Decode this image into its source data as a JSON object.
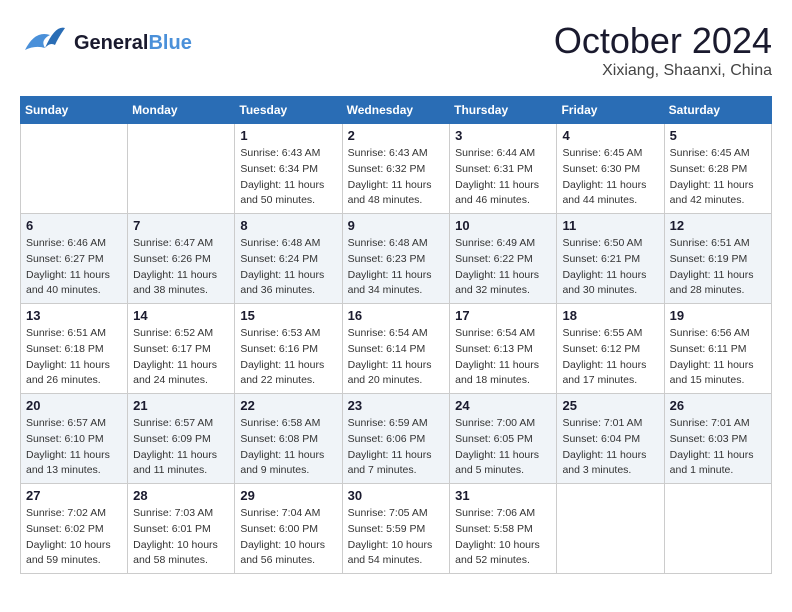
{
  "header": {
    "logo_general": "General",
    "logo_blue": "Blue",
    "month": "October 2024",
    "location": "Xixiang, Shaanxi, China"
  },
  "weekdays": [
    "Sunday",
    "Monday",
    "Tuesday",
    "Wednesday",
    "Thursday",
    "Friday",
    "Saturday"
  ],
  "weeks": [
    [
      {
        "day": "",
        "sunrise": "",
        "sunset": "",
        "daylight": ""
      },
      {
        "day": "",
        "sunrise": "",
        "sunset": "",
        "daylight": ""
      },
      {
        "day": "1",
        "sunrise": "Sunrise: 6:43 AM",
        "sunset": "Sunset: 6:34 PM",
        "daylight": "Daylight: 11 hours and 50 minutes."
      },
      {
        "day": "2",
        "sunrise": "Sunrise: 6:43 AM",
        "sunset": "Sunset: 6:32 PM",
        "daylight": "Daylight: 11 hours and 48 minutes."
      },
      {
        "day": "3",
        "sunrise": "Sunrise: 6:44 AM",
        "sunset": "Sunset: 6:31 PM",
        "daylight": "Daylight: 11 hours and 46 minutes."
      },
      {
        "day": "4",
        "sunrise": "Sunrise: 6:45 AM",
        "sunset": "Sunset: 6:30 PM",
        "daylight": "Daylight: 11 hours and 44 minutes."
      },
      {
        "day": "5",
        "sunrise": "Sunrise: 6:45 AM",
        "sunset": "Sunset: 6:28 PM",
        "daylight": "Daylight: 11 hours and 42 minutes."
      }
    ],
    [
      {
        "day": "6",
        "sunrise": "Sunrise: 6:46 AM",
        "sunset": "Sunset: 6:27 PM",
        "daylight": "Daylight: 11 hours and 40 minutes."
      },
      {
        "day": "7",
        "sunrise": "Sunrise: 6:47 AM",
        "sunset": "Sunset: 6:26 PM",
        "daylight": "Daylight: 11 hours and 38 minutes."
      },
      {
        "day": "8",
        "sunrise": "Sunrise: 6:48 AM",
        "sunset": "Sunset: 6:24 PM",
        "daylight": "Daylight: 11 hours and 36 minutes."
      },
      {
        "day": "9",
        "sunrise": "Sunrise: 6:48 AM",
        "sunset": "Sunset: 6:23 PM",
        "daylight": "Daylight: 11 hours and 34 minutes."
      },
      {
        "day": "10",
        "sunrise": "Sunrise: 6:49 AM",
        "sunset": "Sunset: 6:22 PM",
        "daylight": "Daylight: 11 hours and 32 minutes."
      },
      {
        "day": "11",
        "sunrise": "Sunrise: 6:50 AM",
        "sunset": "Sunset: 6:21 PM",
        "daylight": "Daylight: 11 hours and 30 minutes."
      },
      {
        "day": "12",
        "sunrise": "Sunrise: 6:51 AM",
        "sunset": "Sunset: 6:19 PM",
        "daylight": "Daylight: 11 hours and 28 minutes."
      }
    ],
    [
      {
        "day": "13",
        "sunrise": "Sunrise: 6:51 AM",
        "sunset": "Sunset: 6:18 PM",
        "daylight": "Daylight: 11 hours and 26 minutes."
      },
      {
        "day": "14",
        "sunrise": "Sunrise: 6:52 AM",
        "sunset": "Sunset: 6:17 PM",
        "daylight": "Daylight: 11 hours and 24 minutes."
      },
      {
        "day": "15",
        "sunrise": "Sunrise: 6:53 AM",
        "sunset": "Sunset: 6:16 PM",
        "daylight": "Daylight: 11 hours and 22 minutes."
      },
      {
        "day": "16",
        "sunrise": "Sunrise: 6:54 AM",
        "sunset": "Sunset: 6:14 PM",
        "daylight": "Daylight: 11 hours and 20 minutes."
      },
      {
        "day": "17",
        "sunrise": "Sunrise: 6:54 AM",
        "sunset": "Sunset: 6:13 PM",
        "daylight": "Daylight: 11 hours and 18 minutes."
      },
      {
        "day": "18",
        "sunrise": "Sunrise: 6:55 AM",
        "sunset": "Sunset: 6:12 PM",
        "daylight": "Daylight: 11 hours and 17 minutes."
      },
      {
        "day": "19",
        "sunrise": "Sunrise: 6:56 AM",
        "sunset": "Sunset: 6:11 PM",
        "daylight": "Daylight: 11 hours and 15 minutes."
      }
    ],
    [
      {
        "day": "20",
        "sunrise": "Sunrise: 6:57 AM",
        "sunset": "Sunset: 6:10 PM",
        "daylight": "Daylight: 11 hours and 13 minutes."
      },
      {
        "day": "21",
        "sunrise": "Sunrise: 6:57 AM",
        "sunset": "Sunset: 6:09 PM",
        "daylight": "Daylight: 11 hours and 11 minutes."
      },
      {
        "day": "22",
        "sunrise": "Sunrise: 6:58 AM",
        "sunset": "Sunset: 6:08 PM",
        "daylight": "Daylight: 11 hours and 9 minutes."
      },
      {
        "day": "23",
        "sunrise": "Sunrise: 6:59 AM",
        "sunset": "Sunset: 6:06 PM",
        "daylight": "Daylight: 11 hours and 7 minutes."
      },
      {
        "day": "24",
        "sunrise": "Sunrise: 7:00 AM",
        "sunset": "Sunset: 6:05 PM",
        "daylight": "Daylight: 11 hours and 5 minutes."
      },
      {
        "day": "25",
        "sunrise": "Sunrise: 7:01 AM",
        "sunset": "Sunset: 6:04 PM",
        "daylight": "Daylight: 11 hours and 3 minutes."
      },
      {
        "day": "26",
        "sunrise": "Sunrise: 7:01 AM",
        "sunset": "Sunset: 6:03 PM",
        "daylight": "Daylight: 11 hours and 1 minute."
      }
    ],
    [
      {
        "day": "27",
        "sunrise": "Sunrise: 7:02 AM",
        "sunset": "Sunset: 6:02 PM",
        "daylight": "Daylight: 10 hours and 59 minutes."
      },
      {
        "day": "28",
        "sunrise": "Sunrise: 7:03 AM",
        "sunset": "Sunset: 6:01 PM",
        "daylight": "Daylight: 10 hours and 58 minutes."
      },
      {
        "day": "29",
        "sunrise": "Sunrise: 7:04 AM",
        "sunset": "Sunset: 6:00 PM",
        "daylight": "Daylight: 10 hours and 56 minutes."
      },
      {
        "day": "30",
        "sunrise": "Sunrise: 7:05 AM",
        "sunset": "Sunset: 5:59 PM",
        "daylight": "Daylight: 10 hours and 54 minutes."
      },
      {
        "day": "31",
        "sunrise": "Sunrise: 7:06 AM",
        "sunset": "Sunset: 5:58 PM",
        "daylight": "Daylight: 10 hours and 52 minutes."
      },
      {
        "day": "",
        "sunrise": "",
        "sunset": "",
        "daylight": ""
      },
      {
        "day": "",
        "sunrise": "",
        "sunset": "",
        "daylight": ""
      }
    ]
  ]
}
